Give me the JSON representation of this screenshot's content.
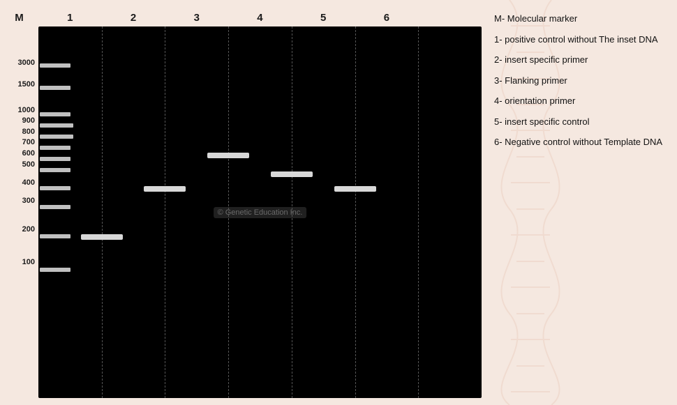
{
  "laneLabels": [
    "M",
    "1",
    "2",
    "3",
    "4",
    "5",
    "6"
  ],
  "mwMarkers": [
    {
      "label": "3000",
      "pct": 10
    },
    {
      "label": "1500",
      "pct": 16
    },
    {
      "label": "1000",
      "pct": 23
    },
    {
      "label": "900",
      "pct": 26
    },
    {
      "label": "800",
      "pct": 29
    },
    {
      "label": "700",
      "pct": 32
    },
    {
      "label": "600",
      "pct": 35
    },
    {
      "label": "500",
      "pct": 38
    },
    {
      "label": "400",
      "pct": 43
    },
    {
      "label": "300",
      "pct": 48
    },
    {
      "label": "200",
      "pct": 56
    },
    {
      "label": "100",
      "pct": 65
    }
  ],
  "watermark": "© Genetic Education Inc.",
  "legend": [
    {
      "id": "M",
      "text": "M- Molecular marker"
    },
    {
      "id": "1",
      "text": "1- positive control without The inset DNA"
    },
    {
      "id": "2",
      "text": "2- insert specific primer"
    },
    {
      "id": "3",
      "text": "3- Flanking primer"
    },
    {
      "id": "4",
      "text": "4- orientation primer"
    },
    {
      "id": "5",
      "text": "5- insert specific control"
    },
    {
      "id": "6",
      "text": "6- Negative control without Template DNA"
    }
  ],
  "bands": [
    {
      "lane": 1,
      "pct": 56,
      "width": 60,
      "comment": "lane1 ~200bp"
    },
    {
      "lane": 2,
      "pct": 43,
      "width": 60,
      "comment": "lane2 ~400bp"
    },
    {
      "lane": 3,
      "pct": 34,
      "width": 60,
      "comment": "lane3 ~600bp"
    },
    {
      "lane": 4,
      "pct": 39,
      "width": 60,
      "comment": "lane4 ~500bp"
    },
    {
      "lane": 5,
      "pct": 43,
      "width": 60,
      "comment": "lane5 ~400bp"
    }
  ]
}
